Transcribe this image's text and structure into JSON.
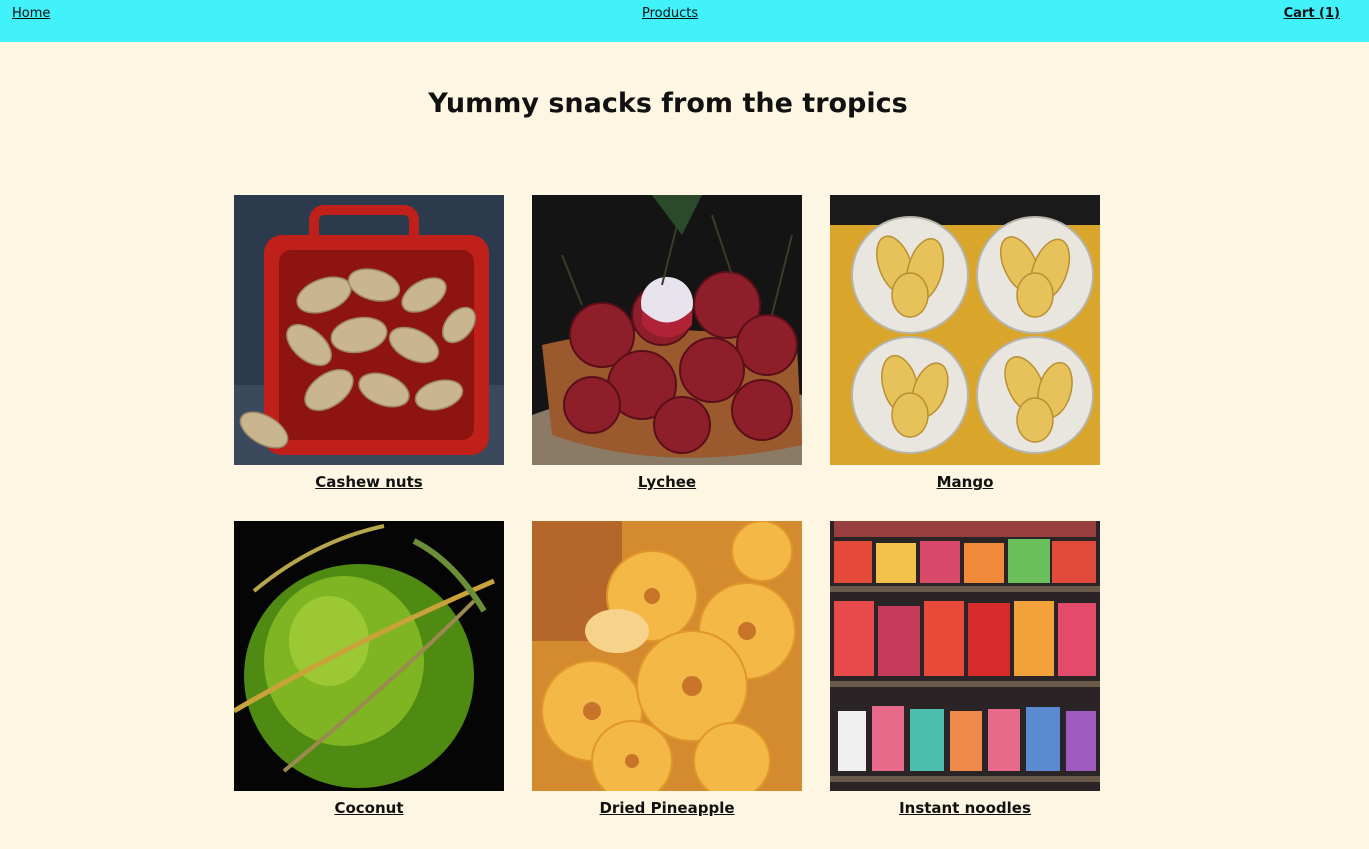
{
  "nav": {
    "home": "Home",
    "products": "Products",
    "cart": "Cart (1)"
  },
  "page": {
    "title": "Yummy snacks from the tropics"
  },
  "products": [
    {
      "name": "Cashew nuts"
    },
    {
      "name": "Lychee"
    },
    {
      "name": "Mango"
    },
    {
      "name": "Coconut"
    },
    {
      "name": "Dried Pineapple"
    },
    {
      "name": "Instant noodles"
    }
  ],
  "colors": {
    "topbar": "#41f2fb",
    "background": "#fdf6e3"
  }
}
